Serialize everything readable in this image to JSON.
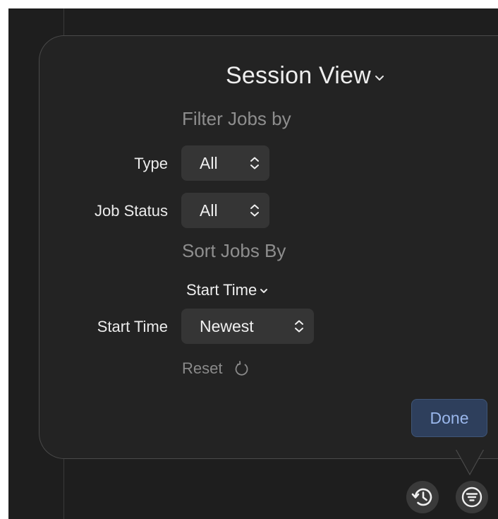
{
  "header": {
    "title": "Session View",
    "title_icon": "chevron-down-icon"
  },
  "filter": {
    "heading": "Filter Jobs by",
    "type_label": "Type",
    "type_value": "All",
    "status_label": "Job Status",
    "status_value": "All"
  },
  "sort": {
    "heading": "Sort Jobs By",
    "key_value": "Start Time",
    "order_label": "Start Time",
    "order_value": "Newest"
  },
  "actions": {
    "reset_label": "Reset",
    "reset_icon": "reset-icon",
    "done_label": "Done"
  },
  "toolbar": {
    "history_icon": "history-icon",
    "filter_icon": "filter-icon"
  },
  "colors": {
    "popover_bg": "#232323",
    "backdrop_bg": "#1e1e1e",
    "done_bg": "#2e3f5c",
    "done_text": "#9ab7ec",
    "secondary_text": "#8e8e8e"
  }
}
